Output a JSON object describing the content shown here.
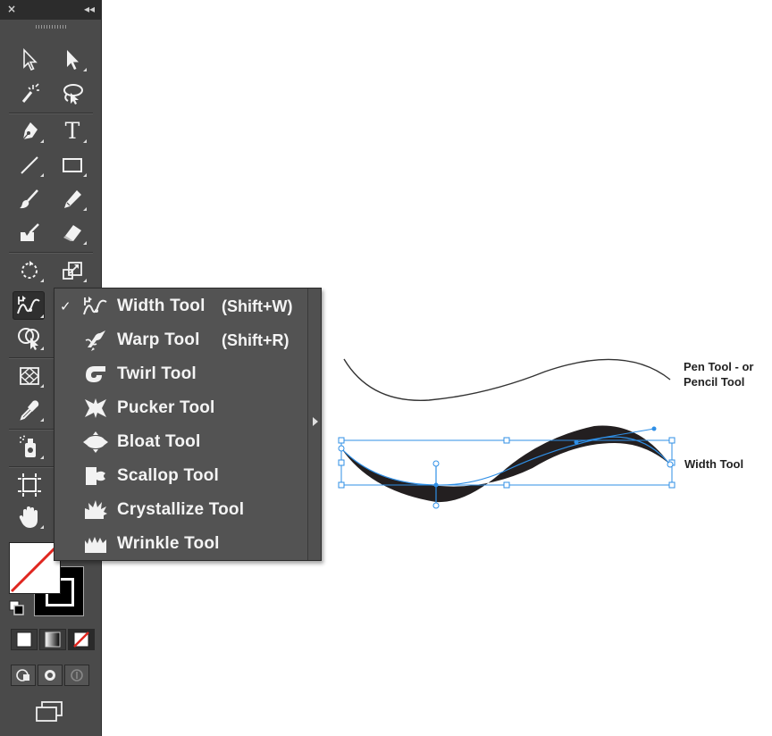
{
  "toolbar": {
    "close_glyph": "×",
    "collapse_glyph": "◂◂",
    "tools": [
      {
        "name": "selection-tool",
        "icon": "selection-arrow-icon"
      },
      {
        "name": "direct-selection-tool",
        "icon": "direct-selection-arrow-icon"
      },
      {
        "name": "magic-wand-tool",
        "icon": "magic-wand-icon"
      },
      {
        "name": "lasso-tool",
        "icon": "lasso-icon"
      },
      {
        "name": "pen-tool",
        "icon": "pen-nib-icon"
      },
      {
        "name": "type-tool",
        "icon": "type-t-icon",
        "glyph": "T"
      },
      {
        "name": "line-segment-tool",
        "icon": "line-icon"
      },
      {
        "name": "rectangle-tool",
        "icon": "rectangle-icon"
      },
      {
        "name": "paintbrush-tool",
        "icon": "paintbrush-icon"
      },
      {
        "name": "pencil-tool",
        "icon": "pencil-icon"
      },
      {
        "name": "blob-brush-tool",
        "icon": "blob-brush-icon"
      },
      {
        "name": "eraser-tool",
        "icon": "eraser-icon"
      },
      {
        "name": "rotate-tool",
        "icon": "rotate-icon"
      },
      {
        "name": "scale-tool",
        "icon": "scale-icon"
      },
      {
        "name": "width-tool",
        "icon": "width-tool-icon"
      },
      {
        "name": "shape-builder-tool",
        "icon": "shape-builder-icon"
      },
      {
        "name": "perspective-grid-tool",
        "icon": "perspective-grid-icon"
      },
      {
        "name": "eyedropper-tool",
        "icon": "eyedropper-icon"
      },
      {
        "name": "symbol-sprayer-tool",
        "icon": "symbol-sprayer-icon"
      },
      {
        "name": "artboard-tool",
        "icon": "artboard-icon"
      },
      {
        "name": "hand-tool",
        "icon": "hand-icon"
      }
    ]
  },
  "flyout": {
    "check_glyph": "✓",
    "items": [
      {
        "label": "Width Tool",
        "shortcut": "(Shift+W)",
        "icon": "width-tool-icon",
        "checked": true
      },
      {
        "label": "Warp Tool",
        "shortcut": "(Shift+R)",
        "icon": "warp-tool-icon",
        "checked": false
      },
      {
        "label": "Twirl Tool",
        "shortcut": "",
        "icon": "twirl-tool-icon",
        "checked": false
      },
      {
        "label": "Pucker Tool",
        "shortcut": "",
        "icon": "pucker-tool-icon",
        "checked": false
      },
      {
        "label": "Bloat Tool",
        "shortcut": "",
        "icon": "bloat-tool-icon",
        "checked": false
      },
      {
        "label": "Scallop Tool",
        "shortcut": "",
        "icon": "scallop-tool-icon",
        "checked": false
      },
      {
        "label": "Crystallize Tool",
        "shortcut": "",
        "icon": "crystallize-tool-icon",
        "checked": false
      },
      {
        "label": "Wrinkle Tool",
        "shortcut": "",
        "icon": "wrinkle-tool-icon",
        "checked": false
      }
    ]
  },
  "canvas": {
    "caption_pen": "Pen Tool - or\nPencil Tool",
    "caption_pen_line1": "Pen Tool - or",
    "caption_pen_line2": "Pencil Tool",
    "caption_width": "Width Tool"
  },
  "colors": {
    "panel_bg": "#4a4a4a",
    "menu_bg": "#535353",
    "selection_blue": "#2f8fe6",
    "none_red": "#e0261f"
  }
}
